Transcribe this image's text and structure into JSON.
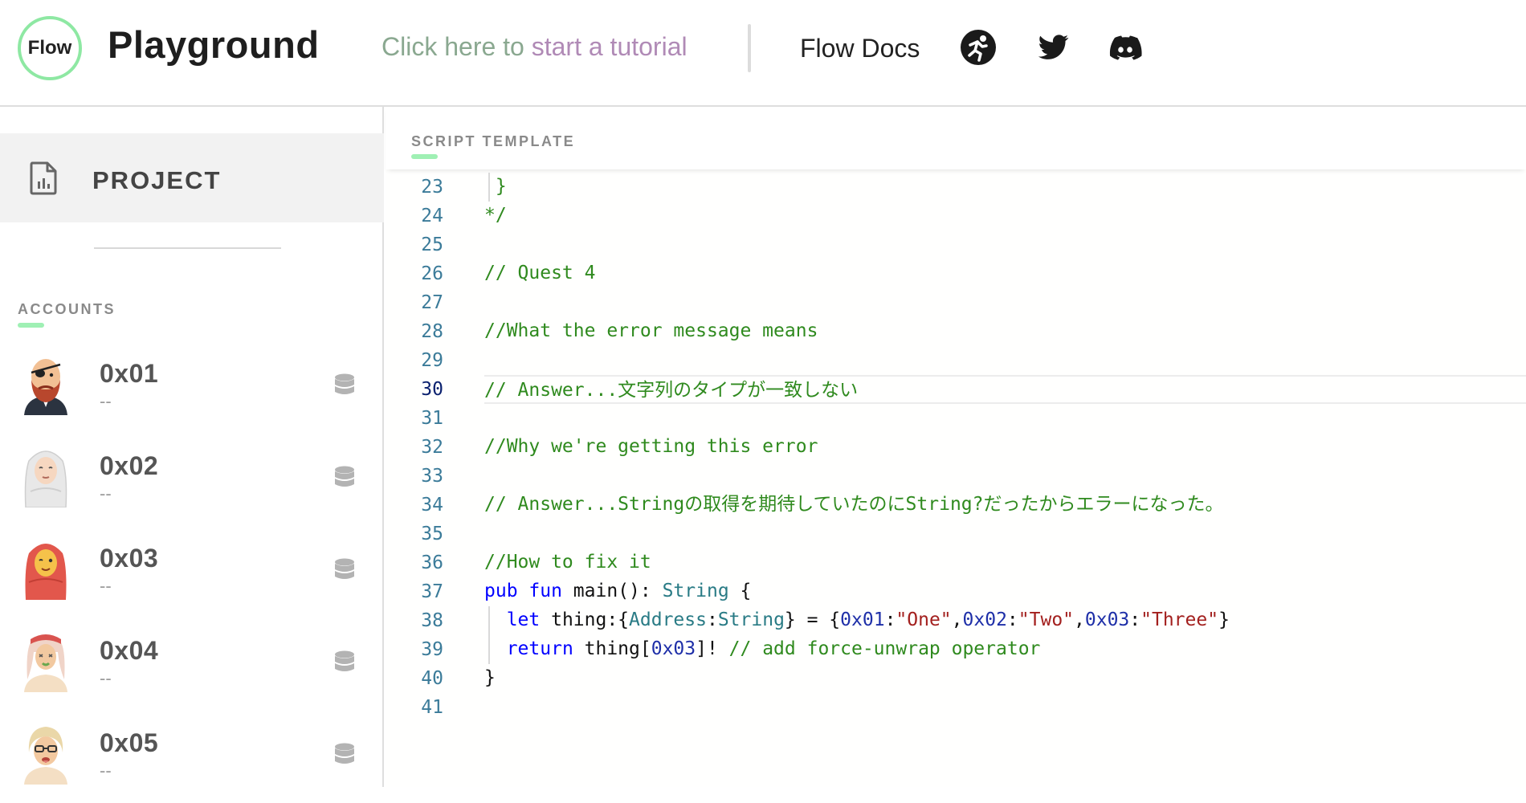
{
  "header": {
    "logo_text": "Flow",
    "app_title": "Playground",
    "tutorial_part1": "Click here to ",
    "tutorial_part2": "start a tutorial",
    "docs_label": "Flow Docs",
    "icons": [
      "flow-runner-icon",
      "twitter-icon",
      "discord-icon"
    ],
    "accent_color": "#8ee8a3"
  },
  "sidebar": {
    "project_label": "PROJECT",
    "accounts_title": "ACCOUNTS",
    "accounts": [
      {
        "address": "0x01",
        "subtitle": "--",
        "avatar": "pirate-avatar"
      },
      {
        "address": "0x02",
        "subtitle": "--",
        "avatar": "elder-hijab-avatar"
      },
      {
        "address": "0x03",
        "subtitle": "--",
        "avatar": "red-hijab-avatar"
      },
      {
        "address": "0x04",
        "subtitle": "--",
        "avatar": "keffiyeh-avatar"
      },
      {
        "address": "0x05",
        "subtitle": "--",
        "avatar": "glasses-avatar"
      }
    ]
  },
  "editor": {
    "title": "SCRIPT TEMPLATE",
    "active_line": 30,
    "lines": [
      {
        "n": "23",
        "tokens": [
          {
            "t": " }",
            "c": "comment"
          }
        ]
      },
      {
        "n": "24",
        "tokens": [
          {
            "t": "*/",
            "c": "comment"
          }
        ]
      },
      {
        "n": "25",
        "tokens": []
      },
      {
        "n": "26",
        "tokens": [
          {
            "t": "// Quest 4",
            "c": "comment"
          }
        ]
      },
      {
        "n": "27",
        "tokens": []
      },
      {
        "n": "28",
        "tokens": [
          {
            "t": "//What the error message means",
            "c": "comment"
          }
        ]
      },
      {
        "n": "29",
        "tokens": []
      },
      {
        "n": "30",
        "tokens": [
          {
            "t": "// Answer...文字列のタイプが一致しない",
            "c": "comment"
          }
        ]
      },
      {
        "n": "31",
        "tokens": []
      },
      {
        "n": "32",
        "tokens": [
          {
            "t": "//Why we're getting this error",
            "c": "comment"
          }
        ]
      },
      {
        "n": "33",
        "tokens": []
      },
      {
        "n": "34",
        "tokens": [
          {
            "t": "// Answer...Stringの取得を期待していたのにString?だったからエラーになった。",
            "c": "comment"
          }
        ]
      },
      {
        "n": "35",
        "tokens": []
      },
      {
        "n": "36",
        "tokens": [
          {
            "t": "//How to fix it",
            "c": "comment"
          }
        ]
      },
      {
        "n": "37",
        "tokens": [
          {
            "t": "pub",
            "c": "kw"
          },
          {
            "t": " ",
            "c": "plain"
          },
          {
            "t": "fun",
            "c": "kw"
          },
          {
            "t": " main(): ",
            "c": "plain"
          },
          {
            "t": "String",
            "c": "type"
          },
          {
            "t": " {",
            "c": "plain"
          }
        ]
      },
      {
        "n": "38",
        "tokens": [
          {
            "t": "  ",
            "c": "plain"
          },
          {
            "t": "let",
            "c": "kw"
          },
          {
            "t": " thing:{",
            "c": "plain"
          },
          {
            "t": "Address",
            "c": "type"
          },
          {
            "t": ":",
            "c": "plain"
          },
          {
            "t": "String",
            "c": "type"
          },
          {
            "t": "} = {",
            "c": "plain"
          },
          {
            "t": "0x01",
            "c": "num"
          },
          {
            "t": ":",
            "c": "plain"
          },
          {
            "t": "\"One\"",
            "c": "str"
          },
          {
            "t": ",",
            "c": "plain"
          },
          {
            "t": "0x02",
            "c": "num"
          },
          {
            "t": ":",
            "c": "plain"
          },
          {
            "t": "\"Two\"",
            "c": "str"
          },
          {
            "t": ",",
            "c": "plain"
          },
          {
            "t": "0x03",
            "c": "num"
          },
          {
            "t": ":",
            "c": "plain"
          },
          {
            "t": "\"Three\"",
            "c": "str"
          },
          {
            "t": "}",
            "c": "plain"
          }
        ]
      },
      {
        "n": "39",
        "tokens": [
          {
            "t": "  ",
            "c": "plain"
          },
          {
            "t": "return",
            "c": "kw"
          },
          {
            "t": " thing[",
            "c": "plain"
          },
          {
            "t": "0x03",
            "c": "num"
          },
          {
            "t": "]! ",
            "c": "plain"
          },
          {
            "t": "// add force-unwrap operator",
            "c": "comment"
          }
        ]
      },
      {
        "n": "40",
        "tokens": [
          {
            "t": "}",
            "c": "plain"
          }
        ]
      },
      {
        "n": "41",
        "tokens": []
      }
    ]
  }
}
